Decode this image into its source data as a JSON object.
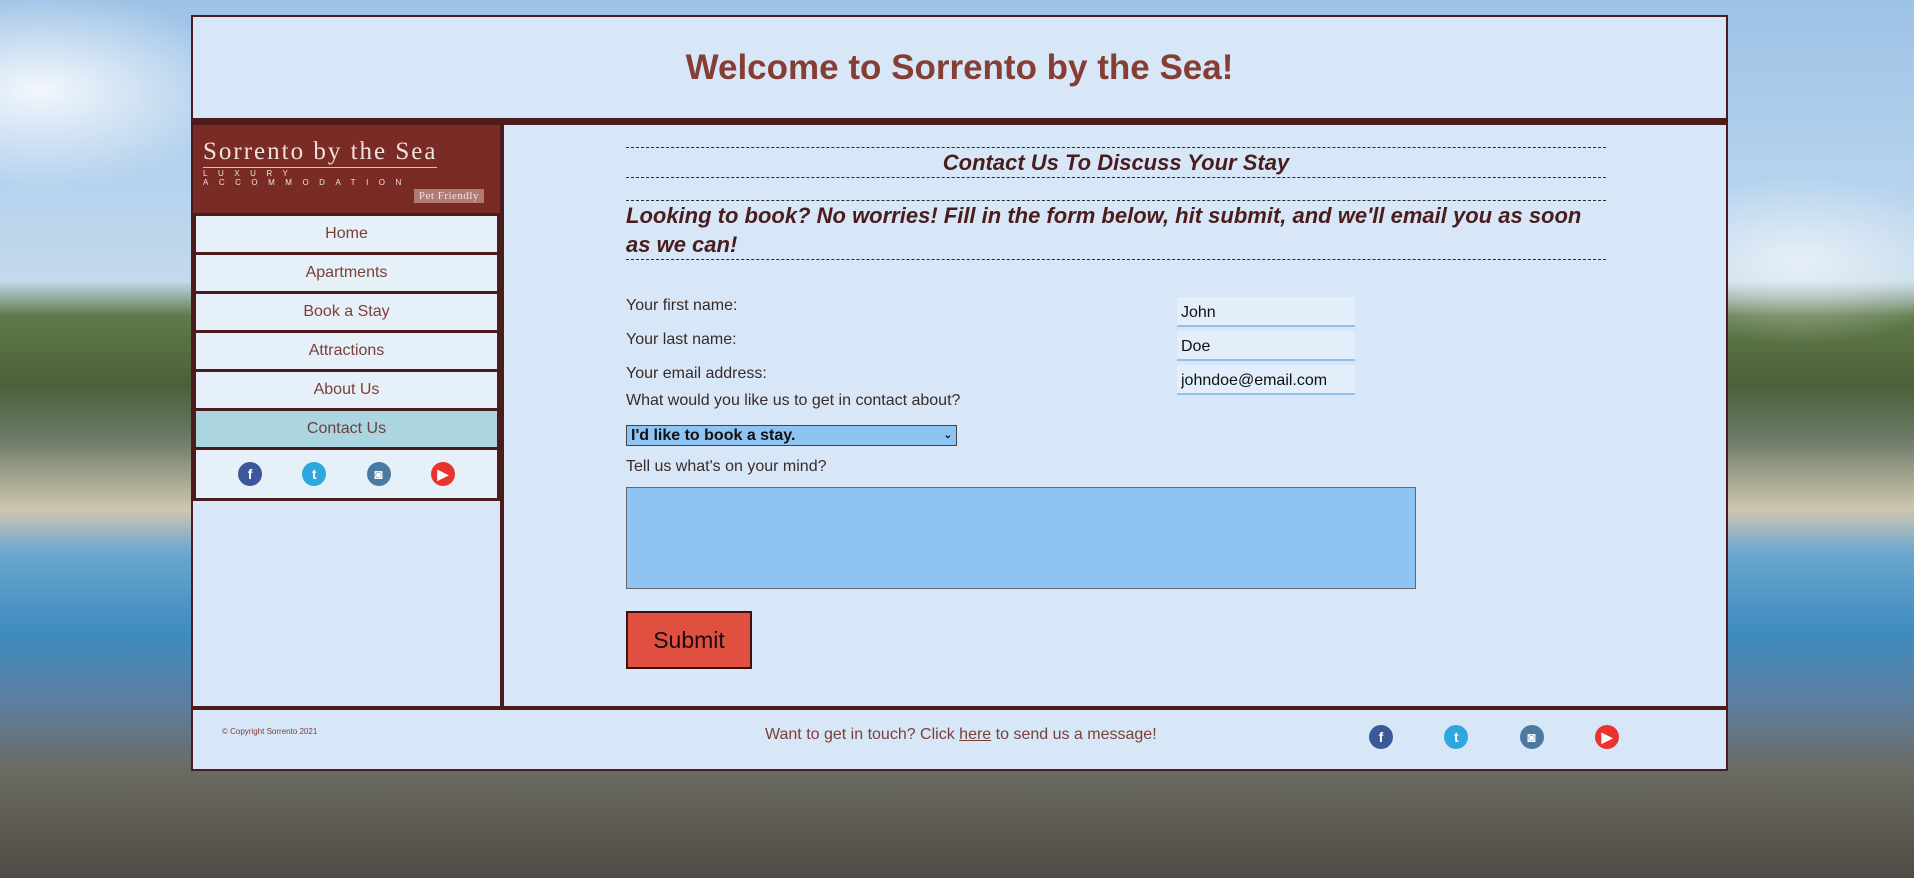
{
  "header": {
    "title": "Welcome to Sorrento by the Sea!"
  },
  "brand": {
    "name": "Sorrento by the Sea",
    "tagline": "LUXURY ACCOMMODATION",
    "badge": "Pet Friendly"
  },
  "nav": {
    "items": [
      {
        "label": "Home"
      },
      {
        "label": "Apartments"
      },
      {
        "label": "Book a Stay"
      },
      {
        "label": "Attractions"
      },
      {
        "label": "About Us"
      },
      {
        "label": "Contact Us",
        "active": true
      }
    ]
  },
  "social": {
    "facebook": "f",
    "twitter": "t",
    "instagram": "◙",
    "youtube": "▶",
    "colors": {
      "facebook": "#3b5998",
      "twitter": "#2ca7e0",
      "instagram": "#4b7aa0",
      "youtube": "#e8332e"
    }
  },
  "main": {
    "title": "Contact Us To Discuss Your Stay",
    "intro": "Looking to book? No worries! Fill in the form below, hit submit, and we'll email you as soon as we can!"
  },
  "form": {
    "first_name_label": "Your first name:",
    "first_name_value": "John",
    "last_name_label": "Your last name:",
    "last_name_value": "Doe",
    "email_label": "Your email address:",
    "email_value": "johndoe@email.com",
    "topic_label": "What would you like us to get in contact about?",
    "topic_selected": "I'd like to book a stay.",
    "message_label": "Tell us what's on your mind?",
    "message_value": "",
    "submit_label": "Submit"
  },
  "footer": {
    "copyright": "© Copyright Sorrento 2021",
    "message_pre": "Want to get in touch? Click ",
    "message_link": "here",
    "message_post": " to send us a message!"
  },
  "colors": {
    "accent": "#863e34",
    "frame": "#4a1c1c",
    "panel": "#d7e7f7",
    "submit": "#e05040"
  }
}
